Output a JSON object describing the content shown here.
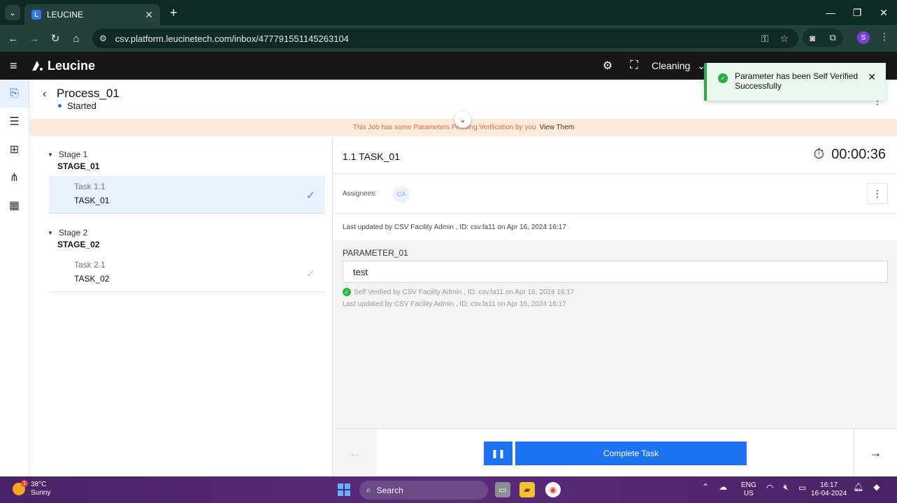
{
  "browser": {
    "tab_title": "LEUCINE",
    "url": "csv.platform.leucinetech.com/inbox/477791551145263104",
    "profile_initial": "S"
  },
  "app": {
    "brand": "Leucine",
    "facility_label": "Cleaning"
  },
  "job": {
    "title": "Process_01",
    "status": "Started",
    "banner_message": "This Job has some Parameters Pending Verification by you",
    "banner_link": "View Them"
  },
  "stages": [
    {
      "label": "Stage 1",
      "name": "STAGE_01",
      "tasks": [
        {
          "label": "Task 1.1",
          "name": "TASK_01",
          "active": true
        }
      ]
    },
    {
      "label": "Stage 2",
      "name": "STAGE_02",
      "tasks": [
        {
          "label": "Task 2.1",
          "name": "TASK_02",
          "active": false
        }
      ]
    }
  ],
  "task": {
    "title": "1.1 TASK_01",
    "timer": "00:00:36",
    "assignees_label": "Assignees:",
    "assignee_initials": "CA",
    "last_updated": "Last updated by CSV Facility Admin , ID: csv.fa11 on Apr 16, 2024 16:17",
    "parameter": {
      "label": "PARAMETER_01",
      "value": "test",
      "self_verified": "Self Verified by CSV Facility Admin , ID: csv.fa11 on Apr 16, 2024 16:17",
      "last_updated": "Last updated by CSV Facility Admin , ID: csv.fa11 on Apr 16, 2024 16:17"
    },
    "complete_label": "Complete Task"
  },
  "toast": {
    "message": "Parameter has been Self Verified Successfully"
  },
  "taskbar": {
    "temperature": "38°C",
    "weather": "Sunny",
    "weather_badge": "1",
    "search_label": "Search",
    "lang_line1": "ENG",
    "lang_line2": "US",
    "time": "16:17",
    "date": "16-04-2024"
  },
  "colors": {
    "accent": "#1d72f2",
    "success": "#27ae40",
    "banner_text": "#e36b33"
  }
}
